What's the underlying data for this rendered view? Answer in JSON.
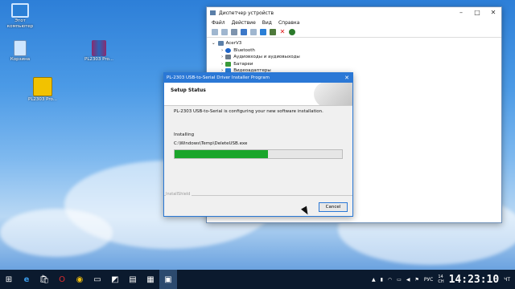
{
  "desktop": {
    "icons": [
      {
        "label": "Этот\nкомпьютер"
      },
      {
        "label": "Корзина"
      },
      {
        "label": "PL2303 Pro..."
      },
      {
        "label": "PL2303 Pro..."
      }
    ]
  },
  "device_manager": {
    "title": "Диспетчер устройств",
    "menu": [
      "Файл",
      "Действие",
      "Вид",
      "Справка"
    ],
    "tree": {
      "root": "AcerV3",
      "items": [
        "Bluetooth",
        "Аудиовходы и аудиовыходы",
        "Батареи",
        "Видеоадаптеры"
      ]
    }
  },
  "installer": {
    "title": "PL-2303 USB-to-Serial Driver Installer Program",
    "header": "Setup Status",
    "message": "PL-2303 USB-to-Serial is configuring your new software installation.",
    "status_label": "Installing",
    "path": "C:\\Windows\\Temp\\DeleteUSB.exe",
    "progress": 0.56,
    "footer": "InstallShield",
    "cancel_label": "Cancel",
    "accent": "#1aa52b"
  },
  "taskbar": {
    "lang": "РУС",
    "date_short": "14\nСН",
    "clock": "14:23:10",
    "day": "ЧТ"
  }
}
